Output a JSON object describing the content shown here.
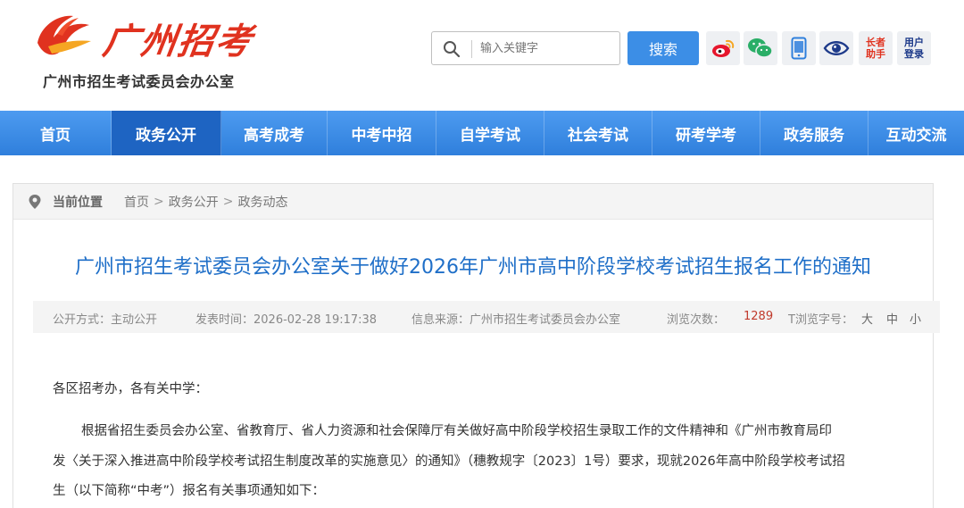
{
  "header": {
    "logo_text": "广州招考",
    "org_name": "广州市招生考试委员会办公室",
    "search_placeholder": "输入关键字",
    "search_button": "搜索",
    "elder_mode": [
      "长者",
      "助手"
    ],
    "user_login": [
      "用户",
      "登录"
    ]
  },
  "nav": {
    "items": [
      "首页",
      "政务公开",
      "高考成考",
      "中考中招",
      "自学考试",
      "社会考试",
      "研考学考",
      "政务服务",
      "互动交流"
    ],
    "active_index": 1
  },
  "breadcrumb": {
    "label": "当前位置",
    "items": [
      "首页",
      "政务公开",
      "政务动态"
    ],
    "separator": ">"
  },
  "article": {
    "title": "广州市招生考试委员会办公室关于做好2026年广州市高中阶段学校考试招生报名工作的通知",
    "meta": {
      "open_mode": "公开方式：主动公开",
      "publish_time": "发表时间：2026-02-28 19:17:38",
      "source": "信息来源：广州市招生考试委员会办公室",
      "views_label": "浏览次数：",
      "views": "1289",
      "font_size_label": "T浏览字号：",
      "font_sizes": [
        "大",
        "中",
        "小"
      ]
    },
    "greeting": "各区招考办，各有关中学：",
    "paragraph_lines": [
      "根据省招生委员会办公室、省教育厅、省人力资源和社会保障厅有关做好高中阶段学校招生录取工作的文件精神和《广州市教育局印",
      "发〈关于深入推进高中阶段学校考试招生制度改革的实施意见〉的通知》（穗教规字〔2023〕1号）要求，现就2026年高中阶段学校考试招",
      "生（以下简称“中考”）报名有关事项通知如下："
    ]
  },
  "colors": {
    "nav_blue": "#3d8de6",
    "nav_active": "#1e64c2",
    "title_blue": "#1f6fc8",
    "logo_red": "#e0321f",
    "views_red": "#c0392b"
  }
}
